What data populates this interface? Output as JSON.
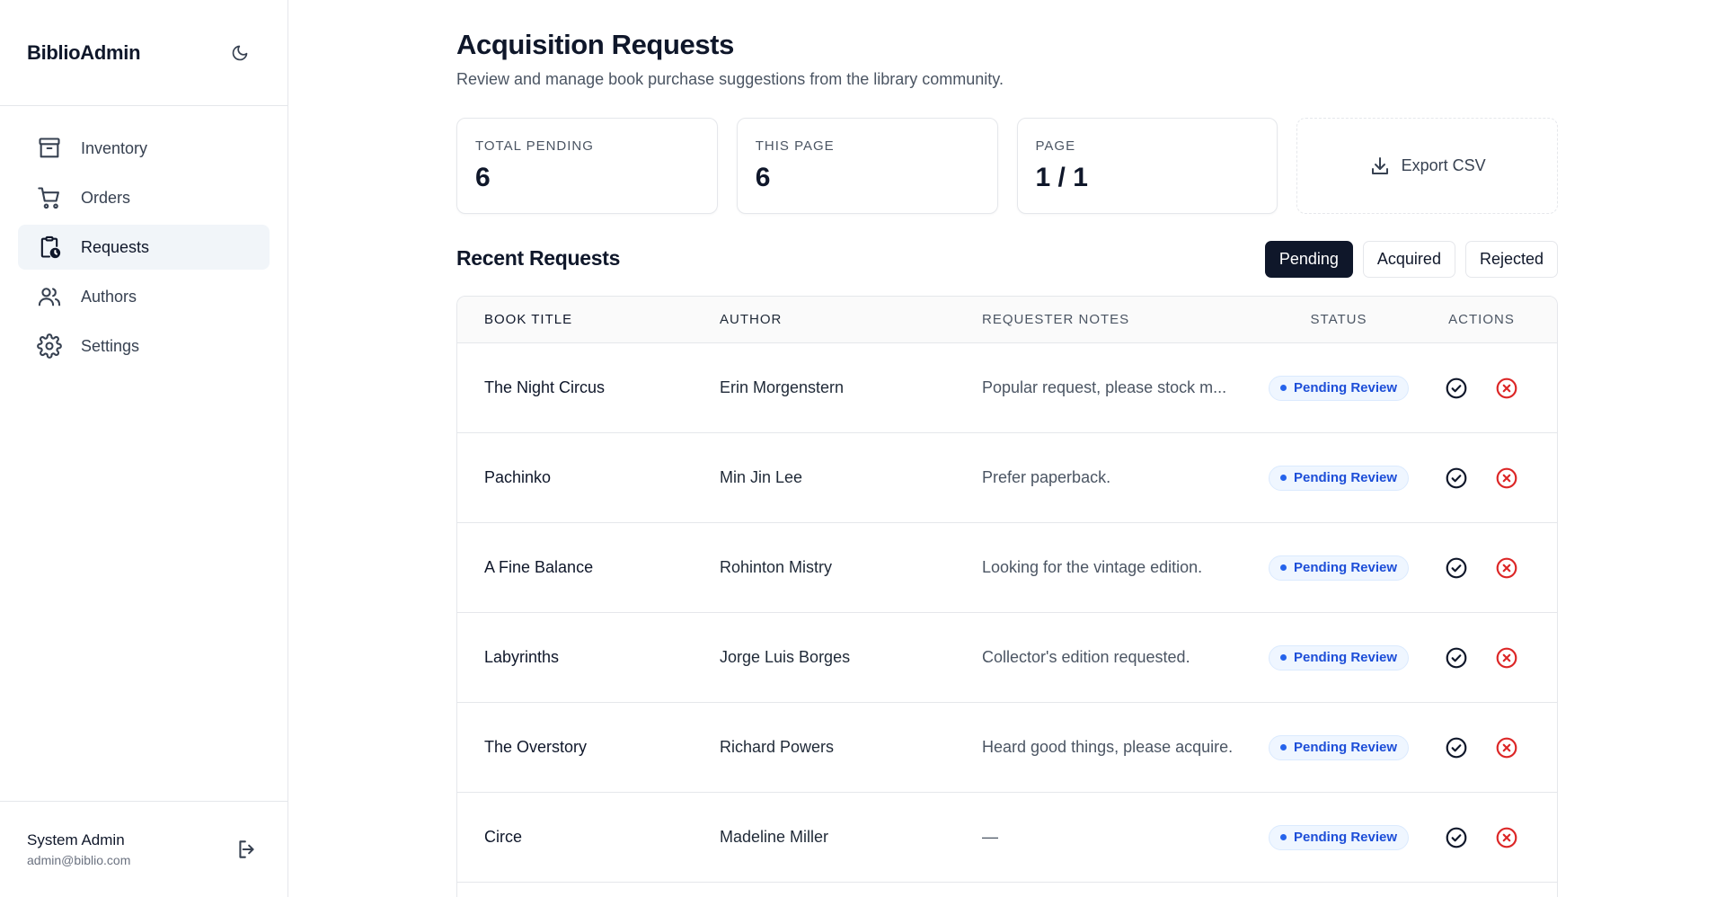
{
  "app": {
    "brand": "BiblioAdmin"
  },
  "sidebar": {
    "items": [
      {
        "label": "Inventory",
        "icon": "archive-icon"
      },
      {
        "label": "Orders",
        "icon": "cart-icon"
      },
      {
        "label": "Requests",
        "icon": "clipboard-clock-icon",
        "active": true
      },
      {
        "label": "Authors",
        "icon": "users-icon"
      },
      {
        "label": "Settings",
        "icon": "gear-icon"
      }
    ],
    "user": {
      "name": "System Admin",
      "email": "admin@biblio.com"
    }
  },
  "header": {
    "title": "Acquisition Requests",
    "subtitle": "Review and manage book purchase suggestions from the library community."
  },
  "stats": [
    {
      "label": "TOTAL PENDING",
      "value": "6"
    },
    {
      "label": "THIS PAGE",
      "value": "6"
    },
    {
      "label": "PAGE",
      "value": "1 / 1"
    }
  ],
  "export": {
    "label": "Export CSV"
  },
  "section": {
    "title": "Recent Requests"
  },
  "filters": [
    {
      "label": "Pending",
      "active": true
    },
    {
      "label": "Acquired",
      "active": false
    },
    {
      "label": "Rejected",
      "active": false
    }
  ],
  "table": {
    "headers": {
      "title": "BOOK TITLE",
      "author": "AUTHOR",
      "notes": "REQUESTER NOTES",
      "status": "STATUS",
      "actions": "ACTIONS"
    },
    "rows": [
      {
        "title": "The Night Circus",
        "author": "Erin Morgenstern",
        "notes": "Popular request, please stock m...",
        "status": "Pending Review"
      },
      {
        "title": "Pachinko",
        "author": "Min Jin Lee",
        "notes": "Prefer paperback.",
        "status": "Pending Review"
      },
      {
        "title": "A Fine Balance",
        "author": "Rohinton Mistry",
        "notes": "Looking for the vintage edition.",
        "status": "Pending Review"
      },
      {
        "title": "Labyrinths",
        "author": "Jorge Luis Borges",
        "notes": "Collector's edition requested.",
        "status": "Pending Review"
      },
      {
        "title": "The Overstory",
        "author": "Richard Powers",
        "notes": "Heard good things, please acquire.",
        "status": "Pending Review"
      },
      {
        "title": "Circe",
        "author": "Madeline Miller",
        "notes": "—",
        "status": "Pending Review"
      }
    ]
  },
  "colors": {
    "accent": "#0f172a",
    "badge_text": "#1d4ed8",
    "badge_bg": "#eff6ff",
    "reject": "#dc2626"
  }
}
